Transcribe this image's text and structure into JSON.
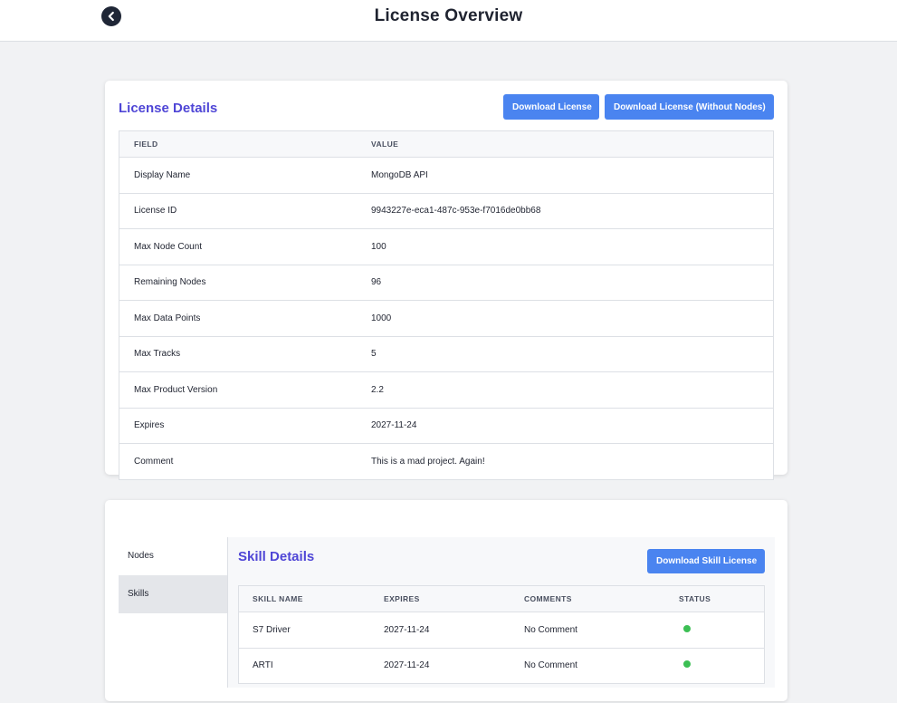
{
  "header": {
    "title": "License Overview",
    "back_icon": "chevron-left-icon"
  },
  "license_details": {
    "title": "License Details",
    "download_label": "Download License",
    "download_without_nodes_label": "Download License (Without Nodes)",
    "columns": {
      "field": "FIELD",
      "value": "VALUE"
    },
    "rows": [
      {
        "field": "Display Name",
        "value": "MongoDB API"
      },
      {
        "field": "License ID",
        "value": "9943227e-eca1-487c-953e-f7016de0bb68"
      },
      {
        "field": "Max Node Count",
        "value": "100"
      },
      {
        "field": "Remaining Nodes",
        "value": "96"
      },
      {
        "field": "Max Data Points",
        "value": "1000"
      },
      {
        "field": "Max Tracks",
        "value": "5"
      },
      {
        "field": "Max Product Version",
        "value": "2.2"
      },
      {
        "field": "Expires",
        "value": "2027-11-24"
      },
      {
        "field": "Comment",
        "value": "This is a mad project. Again!"
      }
    ]
  },
  "side_nav": {
    "items": [
      {
        "label": "Nodes",
        "active": false
      },
      {
        "label": "Skills",
        "active": true
      }
    ]
  },
  "skill_details": {
    "title": "Skill Details",
    "download_label": "Download Skill License",
    "columns": {
      "name": "SKILL NAME",
      "expires": "EXPIRES",
      "comments": "COMMENTS",
      "status": "STATUS"
    },
    "rows": [
      {
        "name": "S7 Driver",
        "expires": "2027-11-24",
        "comments": "No Comment",
        "status": "active"
      },
      {
        "name": "ARTI",
        "expires": "2027-11-24",
        "comments": "No Comment",
        "status": "active"
      }
    ],
    "status_color": "#3cbf54"
  },
  "colors": {
    "accent": "#4a84f0",
    "title": "#4f46d6",
    "background": "#f1f2f4"
  }
}
